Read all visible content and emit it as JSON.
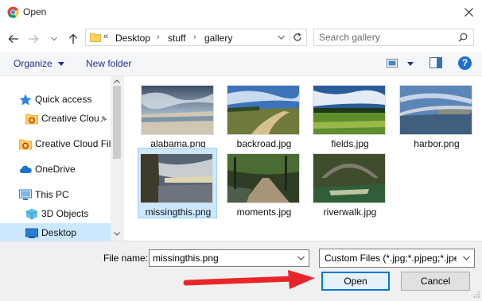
{
  "window": {
    "title": "Open",
    "app_icon": "chrome-icon",
    "close_icon": "close-icon"
  },
  "nav_buttons": [
    "back-arrow-icon",
    "forward-arrow-icon",
    "chevron-down-icon",
    "up-arrow-icon"
  ],
  "address": {
    "overflow": "«",
    "crumbs": [
      "Desktop",
      "stuff",
      "gallery"
    ],
    "separator": "›"
  },
  "search": {
    "placeholder": "Search gallery",
    "value": ""
  },
  "toolbar": {
    "organize_label": "Organize",
    "new_folder_label": "New folder",
    "help_label": "?"
  },
  "nav_pane": {
    "items": [
      {
        "label": "Quick access",
        "icon": "star-icon"
      },
      {
        "label": "Creative Clou",
        "icon": "creative-cloud-folder-icon",
        "pinned": true
      },
      {
        "label": "Creative Cloud Fil",
        "icon": "creative-cloud-folder-icon"
      },
      {
        "label": "OneDrive",
        "icon": "onedrive-cloud-icon"
      },
      {
        "label": "This PC",
        "icon": "computer-icon"
      },
      {
        "label": "3D Objects",
        "icon": "cube-icon"
      },
      {
        "label": "Desktop",
        "icon": "desktop-icon",
        "selected": true
      }
    ]
  },
  "files": [
    {
      "name": "alabama.png"
    },
    {
      "name": "backroad.jpg"
    },
    {
      "name": "fields.jpg"
    },
    {
      "name": "harbor.png"
    },
    {
      "name": "missingthis.png",
      "selected": true
    },
    {
      "name": "moments.jpg"
    },
    {
      "name": "riverwalk.jpg"
    }
  ],
  "footer": {
    "file_name_label": "File name:",
    "file_name_value": "missingthis.png",
    "filter_value": "Custom Files (*.jpg;*.pjpeg;*.jpeg",
    "open_label": "Open",
    "cancel_label": "Cancel"
  },
  "colors": {
    "accent": "#0078d7",
    "selection": "#cce8ff",
    "link": "#1e3287",
    "annotation_arrow": "#e8262a"
  }
}
